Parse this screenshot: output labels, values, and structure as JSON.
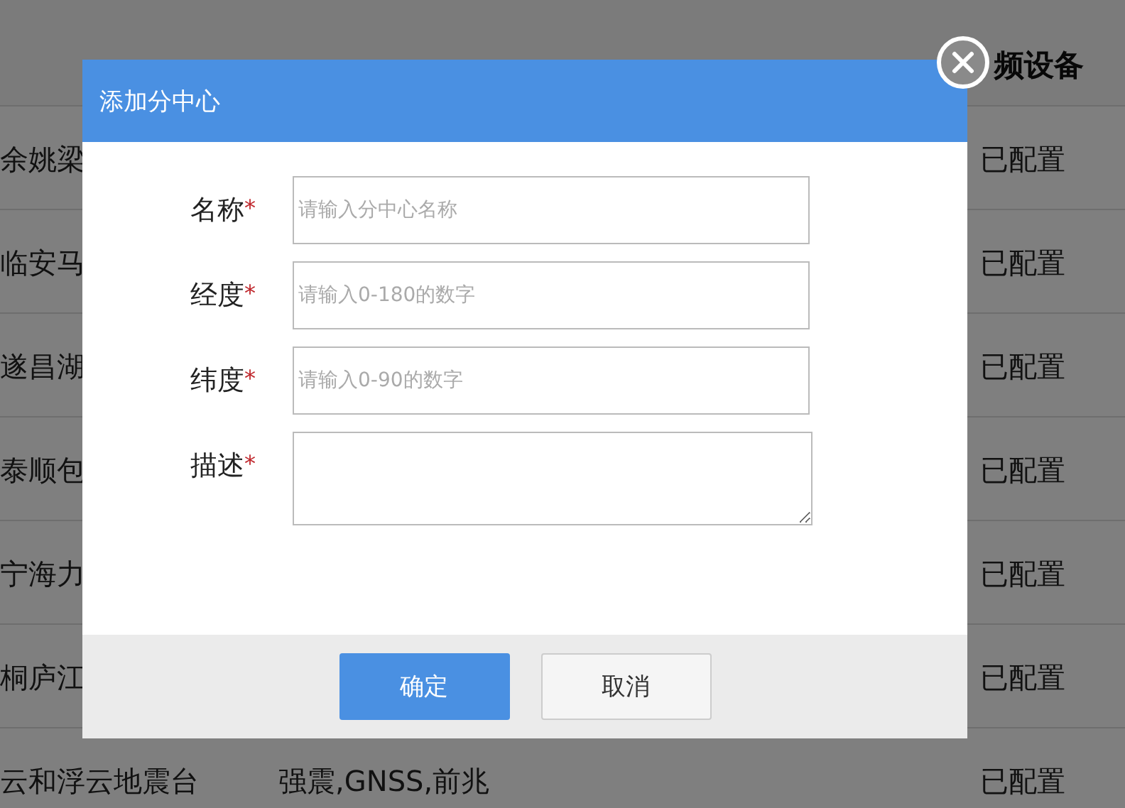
{
  "table": {
    "columns": [
      "频设备"
    ],
    "rows": [
      {
        "name": "余姚梁",
        "video": "已配置"
      },
      {
        "name": "临安马",
        "video": "已配置"
      },
      {
        "name": "遂昌湖",
        "video": "已配置"
      },
      {
        "name": "泰顺包",
        "video": "已配置"
      },
      {
        "name": "宁海力",
        "video": "已配置"
      },
      {
        "name": "桐庐江",
        "video": "已配置"
      },
      {
        "name": "云和浮云地震台",
        "type": "强震,GNSS,前兆",
        "video": "已配置"
      }
    ]
  },
  "dialog": {
    "title": "添加分中心",
    "fields": [
      {
        "kind": "input",
        "label": "名称",
        "required_mark": "*",
        "placeholder": "请输入分中心名称"
      },
      {
        "kind": "input",
        "label": "经度",
        "required_mark": "*",
        "placeholder": "请输入0-180的数字"
      },
      {
        "kind": "input",
        "label": "纬度",
        "required_mark": "*",
        "placeholder": "请输入0-90的数字"
      },
      {
        "kind": "textarea",
        "label": "描述",
        "required_mark": "*"
      }
    ],
    "buttons": [
      {
        "label": "确定",
        "kind": "primary"
      },
      {
        "label": "取消",
        "kind": "default"
      }
    ]
  }
}
